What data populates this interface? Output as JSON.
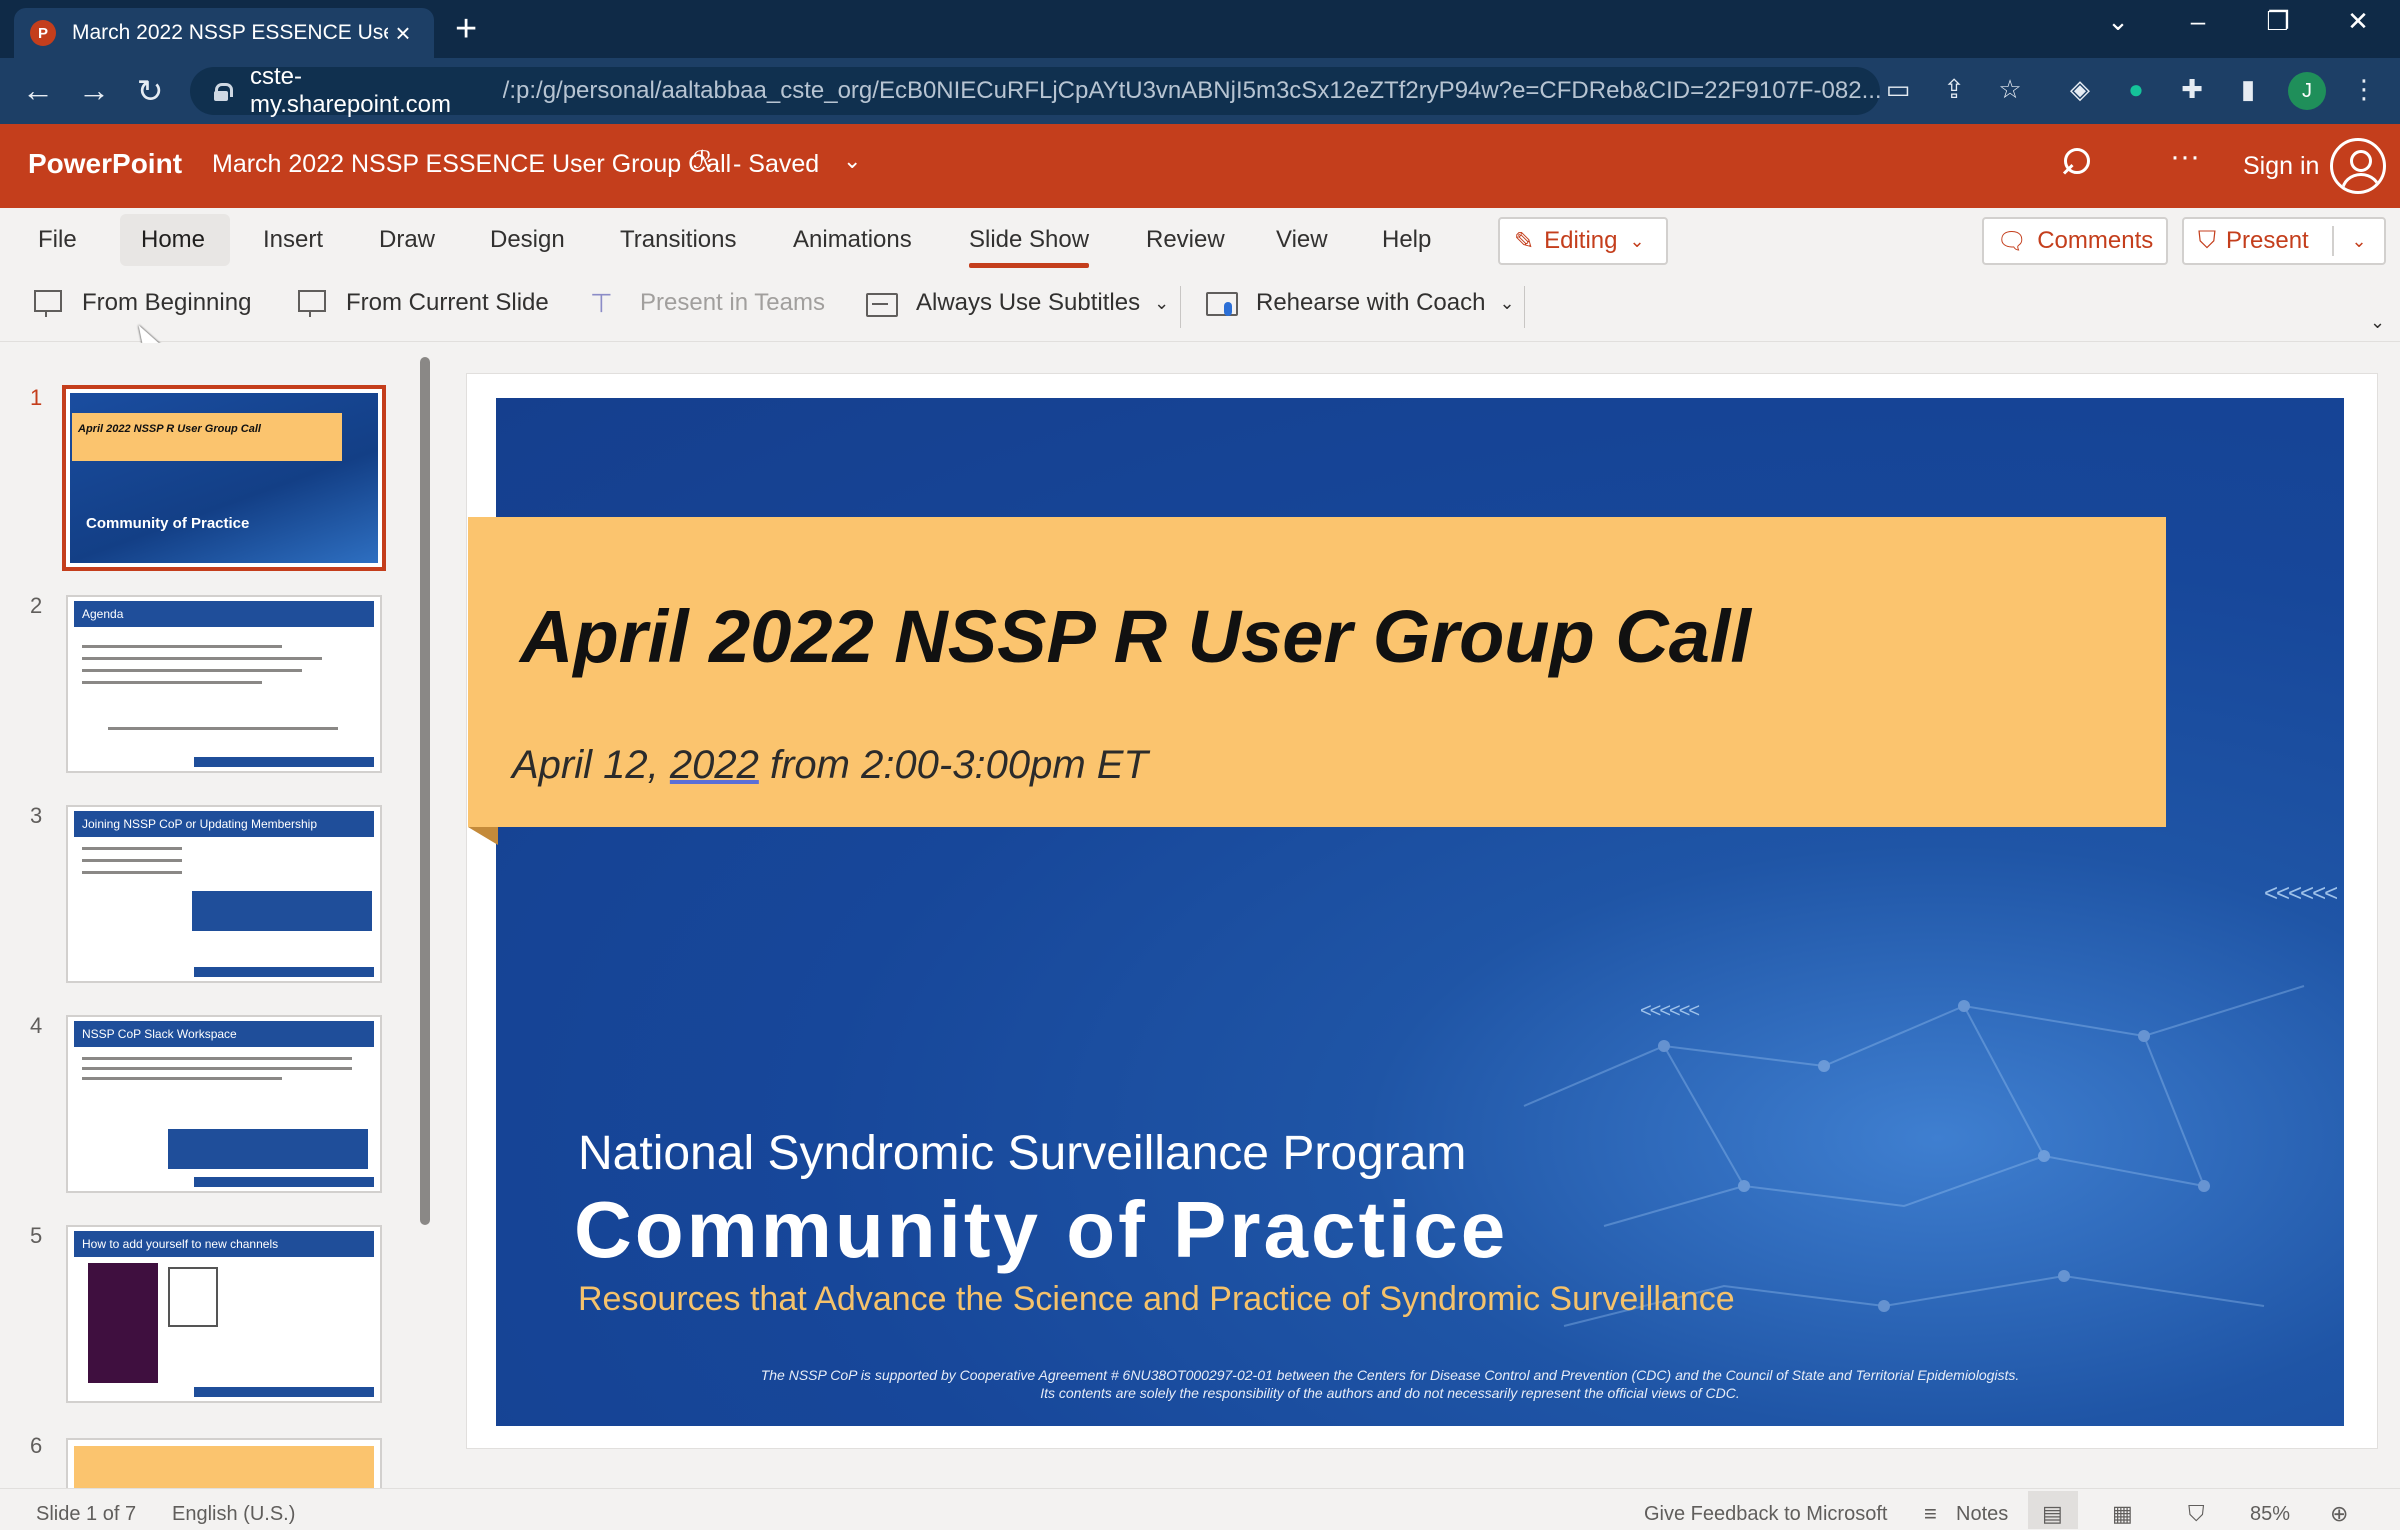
{
  "browser": {
    "tab_title": "March 2022 NSSP ESSENCE User Group Call",
    "tab_favicon": "P",
    "url_host": "cste-my.sharepoint.com",
    "url_path": "/:p:/g/personal/aaltabbaa_cste_org/EcB0NIECuRFLjCpAYtU3vnABNjI5m3cSx12eZTf2ryP94w?e=CFDReb&CID=22F9107F-082...",
    "profile_initial": "J"
  },
  "app": {
    "name": "PowerPoint",
    "doc_title": "March 2022 NSSP ESSENCE User Group Call",
    "saved_status": "-  Saved",
    "sign_in": "Sign in"
  },
  "ribbon": {
    "tabs": [
      "File",
      "Home",
      "Insert",
      "Draw",
      "Design",
      "Transitions",
      "Animations",
      "Slide Show",
      "Review",
      "View",
      "Help"
    ],
    "editing_label": "Editing",
    "comments_label": "Comments",
    "present_label": "Present",
    "commands": {
      "from_beginning": "From Beginning",
      "from_current": "From Current Slide",
      "present_teams": "Present in Teams",
      "subtitles": "Always Use Subtitles",
      "coach": "Rehearse with Coach"
    }
  },
  "thumbnails": [
    {
      "num": "1",
      "title": "April 2022 NSSP R User Group Call"
    },
    {
      "num": "2",
      "title": "Agenda"
    },
    {
      "num": "3",
      "title": "Joining NSSP CoP or Updating Membership"
    },
    {
      "num": "4",
      "title": "NSSP CoP Slack Workspace"
    },
    {
      "num": "5",
      "title": "How to add yourself to new channels"
    },
    {
      "num": "6",
      "title": ""
    }
  ],
  "thumb1": {
    "date": "April 12, 2022 from 2:00-3:00pm ET",
    "program": "National Syndromic Surveillance Program",
    "cop": "Community of Practice"
  },
  "slide": {
    "title": "April 2022 NSSP R User Group Call",
    "subtitle_pre": "April 12, ",
    "subtitle_date": "2022",
    "subtitle_post": " from 2:00-3:00pm ET",
    "program": "National Syndromic Surveillance Program",
    "community": "Community of Practice",
    "resources": "Resources that Advance the Science and Practice of Syndromic Surveillance",
    "disclaimer_1": "The NSSP CoP is supported by Cooperative Agreement # 6NU38OT000297-02-01 between the Centers for Disease Control and Prevention (CDC) and the Council of State and Territorial Epidemiologists.",
    "disclaimer_2": "Its contents are solely the responsibility of the authors and do not necessarily represent the official views of CDC.",
    "arrows_right": "<<<<<<",
    "arrows_mid": "<<<<<<"
  },
  "status": {
    "slide_count": "Slide 1 of 7",
    "language": "English (U.S.)",
    "feedback": "Give Feedback to Microsoft",
    "notes": "Notes",
    "zoom": "85%"
  },
  "colors": {
    "accent": "#c43e1c",
    "slide_blue": "#17479a",
    "title_band": "#fbc46e"
  }
}
